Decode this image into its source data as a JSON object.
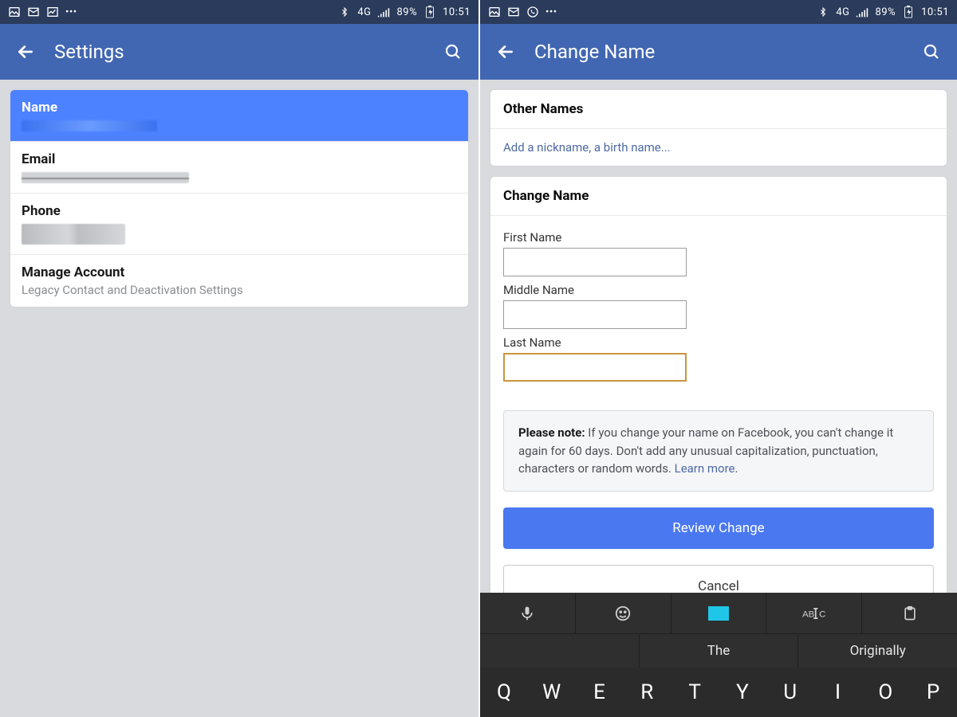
{
  "left": {
    "statusbar": {
      "network": "4G",
      "battery": "89%",
      "time": "10:51"
    },
    "appbar": {
      "title": "Settings"
    },
    "rows": [
      {
        "label": "Name",
        "sub": ""
      },
      {
        "label": "Email",
        "sub": ""
      },
      {
        "label": "Phone",
        "sub": ""
      },
      {
        "label": "Manage Account",
        "sub": "Legacy Contact and Deactivation Settings"
      }
    ]
  },
  "right": {
    "statusbar": {
      "network": "4G",
      "battery": "89%",
      "time": "10:51"
    },
    "appbar": {
      "title": "Change Name"
    },
    "other_names": {
      "header": "Other Names",
      "add_link": "Add a nickname, a birth name..."
    },
    "form": {
      "header": "Change Name",
      "fields": {
        "first": "First Name",
        "middle": "Middle Name",
        "last": "Last Name"
      },
      "note_prefix": "Please note:",
      "note_body": " If you change your name on Facebook, you can't change it again for 60 days. Don't add any unusual capitalization, punctuation, characters or random words. ",
      "note_link": "Learn more",
      "review_btn": "Review Change",
      "cancel_btn": "Cancel"
    },
    "keyboard": {
      "suggestions": [
        "",
        "The",
        "Originally"
      ],
      "row1": [
        "Q",
        "W",
        "E",
        "R",
        "T",
        "Y",
        "U",
        "I",
        "O",
        "P"
      ]
    }
  }
}
